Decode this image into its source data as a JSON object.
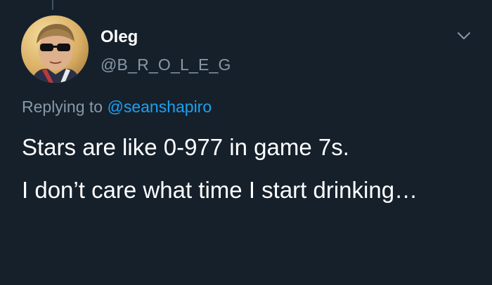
{
  "author": {
    "display_name": "Oleg",
    "handle": "@B_R_O_L_E_G"
  },
  "reply": {
    "prefix": "Replying to",
    "mention": "@seanshapiro"
  },
  "tweet": {
    "paragraphs": [
      "Stars are like 0-977 in game 7s.",
      "I don’t care what time I start drinking…"
    ]
  },
  "icons": {
    "menu": "chevron-down-icon",
    "avatar": "profile-photo"
  },
  "colors": {
    "background": "#15202b",
    "text": "#ffffff",
    "secondary_text": "#8899a6",
    "link": "#1da1f2"
  }
}
